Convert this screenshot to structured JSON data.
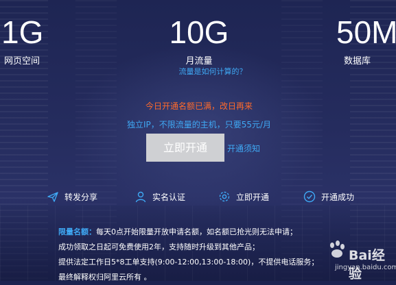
{
  "stats": [
    {
      "value": "1G",
      "label": "网页空间"
    },
    {
      "value": "10G",
      "label": "月流量"
    },
    {
      "value": "50M",
      "label": "数据库"
    }
  ],
  "calc_link": "流量是如何计算的？",
  "full_message": "今日开通名额已满，改日再来",
  "tagline": "独立IP，不限流量的主机，只要55元/月",
  "open_button": "立即开通",
  "notice_link": "开通须知",
  "steps": [
    {
      "label": "转发分享",
      "icon": "share-icon"
    },
    {
      "label": "实名认证",
      "icon": "user-icon"
    },
    {
      "label": "立即开通",
      "icon": "gear-icon"
    },
    {
      "label": "开通成功",
      "icon": "check-circle-icon"
    }
  ],
  "rules": {
    "heading": "限量名额：",
    "line1": "每天0点开始限量开放申请名额，如名额已抢光则无法申请；",
    "line2": "成功领取之日起可免费使用2年，支持随时升级到其他产品；",
    "line3": "提供法定工作日5*8工单支持(9:00-12:00,13:00-18:00)，不提供电话服务；",
    "line4": "最终解释权归阿里云所有 。"
  },
  "watermark": {
    "brand": "Bai经验",
    "url": "jingyan.baidu.com"
  },
  "colors": {
    "accent": "#3fa9f5",
    "warning": "#ff6a2b",
    "button": "#cfd0d3",
    "background": "#1c2350"
  }
}
